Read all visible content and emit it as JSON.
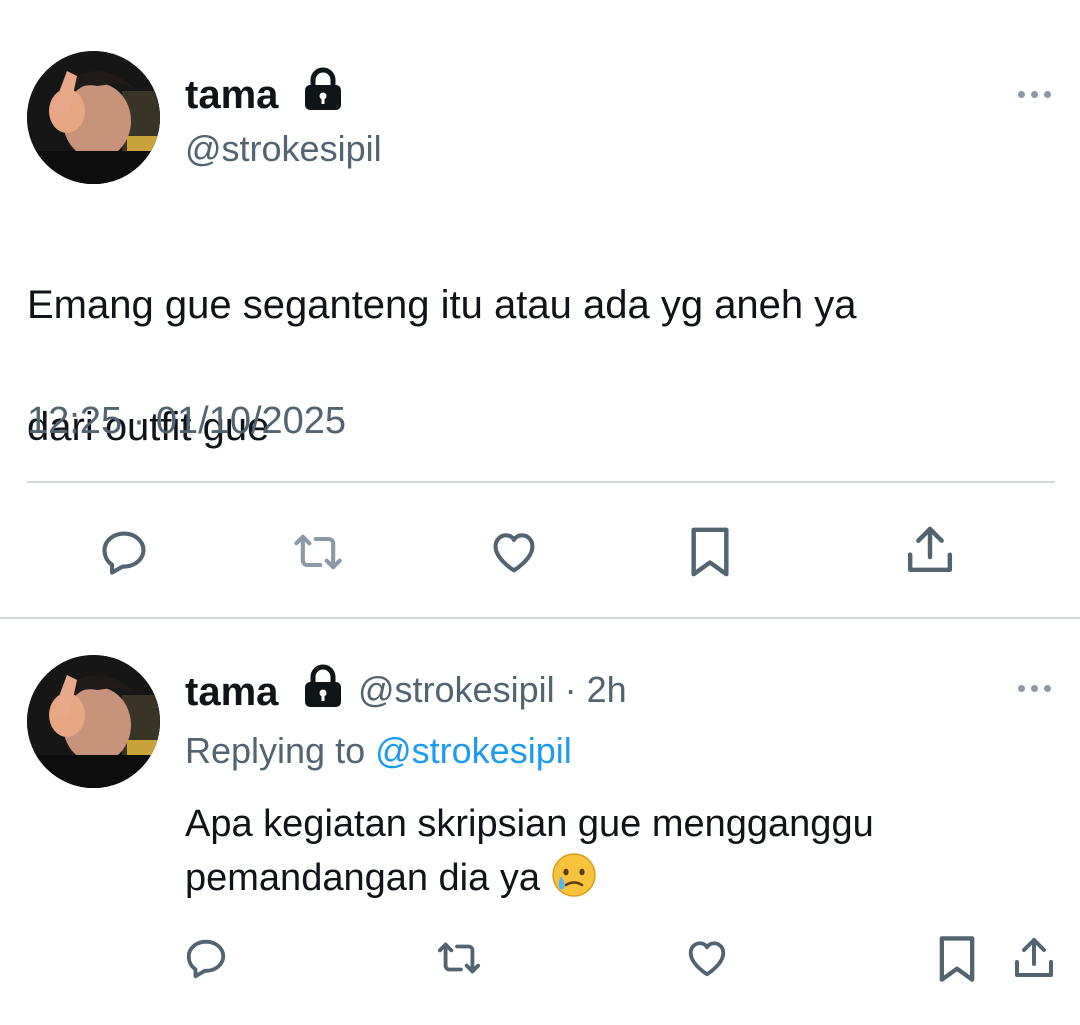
{
  "main_tweet": {
    "author_name": "tama",
    "author_handle": "@strokesipil",
    "text_line1": "Emang gue seganteng itu atau ada yg aneh ya",
    "text_line2": "dari outfit gue",
    "timestamp": "12:25 · 01/10/2025",
    "actions": [
      "reply-icon",
      "retweet-icon",
      "like-icon",
      "bookmark-icon",
      "share-icon"
    ]
  },
  "reply_tweet": {
    "author_name": "tama",
    "author_handle": "@strokesipil",
    "separator": "·",
    "relative_time": "2h",
    "replying_label": "Replying to",
    "replying_handle": "@strokesipil",
    "text_line1": "Apa kegiatan skripsian gue mengganggu",
    "text_line2": "pemandangan dia ya",
    "emoji": "face-holding-back-tears",
    "actions": [
      "reply-icon",
      "retweet-icon",
      "like-icon",
      "bookmark-icon",
      "share-icon"
    ]
  },
  "colors": {
    "text_primary": "#0f1419",
    "text_secondary": "#536471",
    "link": "#1d9bf0",
    "divider": "#cfd9de"
  }
}
